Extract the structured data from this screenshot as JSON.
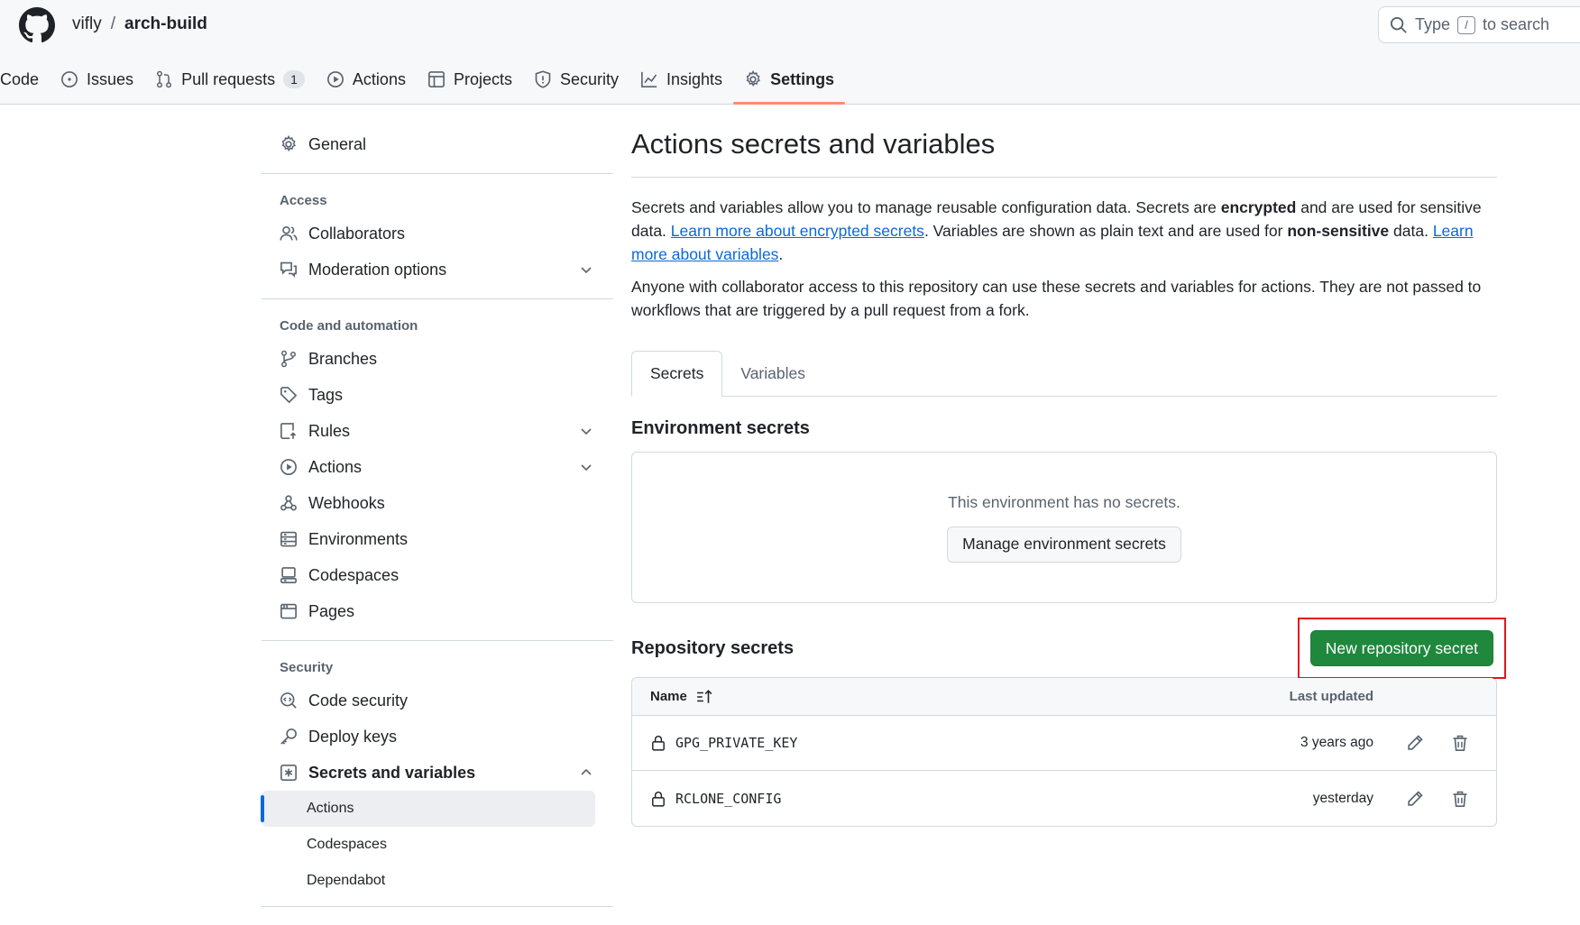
{
  "header": {
    "owner": "vifly",
    "separator": "/",
    "repo": "arch-build",
    "search": {
      "before": "Type",
      "key": "/",
      "after": "to search"
    }
  },
  "nav": {
    "tabs": [
      {
        "label": "Code",
        "icon": "code-icon"
      },
      {
        "label": "Issues",
        "icon": "issue-icon"
      },
      {
        "label": "Pull requests",
        "icon": "pull-request-icon",
        "count": "1"
      },
      {
        "label": "Actions",
        "icon": "play-icon"
      },
      {
        "label": "Projects",
        "icon": "table-icon"
      },
      {
        "label": "Security",
        "icon": "shield-icon"
      },
      {
        "label": "Insights",
        "icon": "graph-icon"
      },
      {
        "label": "Settings",
        "icon": "gear-icon",
        "active": true
      }
    ]
  },
  "sidebar": {
    "general": "General",
    "access_heading": "Access",
    "collaborators": "Collaborators",
    "moderation": "Moderation options",
    "code_heading": "Code and automation",
    "branches": "Branches",
    "tags": "Tags",
    "rules": "Rules",
    "actions": "Actions",
    "webhooks": "Webhooks",
    "environments": "Environments",
    "codespaces": "Codespaces",
    "pages": "Pages",
    "security_heading": "Security",
    "code_security": "Code security",
    "deploy_keys": "Deploy keys",
    "secrets_vars": "Secrets and variables",
    "sub_actions": "Actions",
    "sub_codespaces": "Codespaces",
    "sub_dependabot": "Dependabot"
  },
  "main": {
    "title": "Actions secrets and variables",
    "p1_a": "Secrets and variables allow you to manage reusable configuration data. Secrets are ",
    "p1_b": "encrypted",
    "p1_c": " and are used for sensitive data. ",
    "p1_link1": "Learn more about encrypted secrets",
    "p1_d": ". Variables are shown as plain text and are used for ",
    "p1_e": "non-sensitive",
    "p1_f": " data. ",
    "p1_link2": "Learn more about variables",
    "p1_g": ".",
    "p2": "Anyone with collaborator access to this repository can use these secrets and variables for actions. They are not passed to workflows that are triggered by a pull request from a fork.",
    "tab_secrets": "Secrets",
    "tab_variables": "Variables",
    "env_heading": "Environment secrets",
    "env_empty": "This environment has no secrets.",
    "env_button": "Manage environment secrets",
    "repo_heading": "Repository secrets",
    "new_secret_button": "New repository secret",
    "col_name": "Name",
    "col_updated": "Last updated",
    "secrets": [
      {
        "name": "GPG_PRIVATE_KEY",
        "updated": "3 years ago"
      },
      {
        "name": "RCLONE_CONFIG",
        "updated": "yesterday"
      }
    ]
  },
  "colors": {
    "accent": "#fd8c73",
    "link": "#0969da",
    "primary_button": "#1f883d",
    "highlight_box": "#e5141c"
  }
}
